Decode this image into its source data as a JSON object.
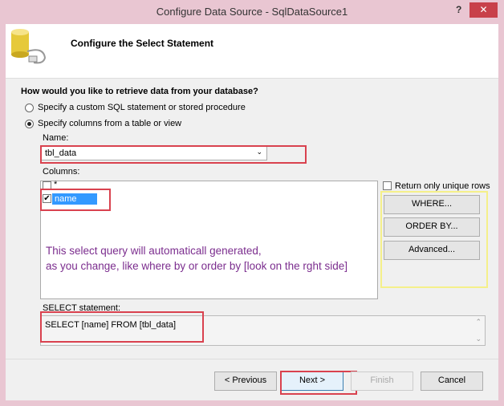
{
  "window": {
    "title": "Configure Data Source - SqlDataSource1",
    "help": "?",
    "close": "✕"
  },
  "header": {
    "title": "Configure the Select Statement",
    "icon": "database-icon"
  },
  "question": "How would you like to retrieve data from your database?",
  "options": [
    {
      "label": "Specify a custom SQL statement or stored procedure",
      "selected": false
    },
    {
      "label": "Specify columns from a table or view",
      "selected": true
    }
  ],
  "name_label": "Name:",
  "name_value": "tbl_data",
  "columns_label": "Columns:",
  "columns": [
    {
      "label": "*",
      "checked": false
    },
    {
      "label": "name",
      "checked": true
    }
  ],
  "annotation": [
    "This select query will automaticall generated,",
    "as you change, like where by or order by [look on the rght side]"
  ],
  "unique_rows": {
    "label": "Return only unique rows",
    "checked": false
  },
  "side_buttons": {
    "where": "WHERE...",
    "order_by": "ORDER BY...",
    "advanced": "Advanced..."
  },
  "select_label": "SELECT statement:",
  "select_value": "SELECT [name] FROM [tbl_data]",
  "footer": {
    "previous": "< Previous",
    "next": "Next >",
    "finish": "Finish",
    "cancel": "Cancel"
  },
  "colors": {
    "annotation": "#7b2d8e",
    "highlight": "#3399ff",
    "callout": "#d9424f",
    "yellow": "#f5f08a"
  }
}
